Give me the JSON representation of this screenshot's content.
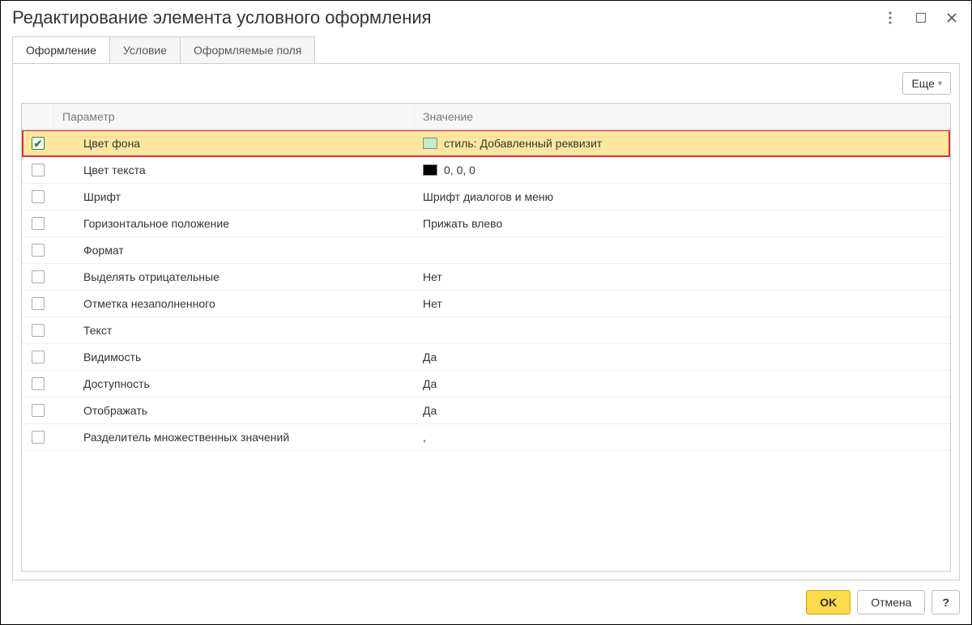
{
  "window": {
    "title": "Редактирование элемента условного оформления"
  },
  "tabs": {
    "design": "Оформление",
    "condition": "Условие",
    "fields": "Оформляемые поля",
    "active": "design"
  },
  "toolbar": {
    "more_label": "Еще"
  },
  "grid": {
    "header_param": "Параметр",
    "header_value": "Значение",
    "rows": [
      {
        "checked": true,
        "selected": true,
        "param": "Цвет фона",
        "value": "стиль: Добавленный реквизит",
        "swatch": "green"
      },
      {
        "checked": false,
        "selected": false,
        "param": "Цвет текста",
        "value": "0, 0, 0",
        "swatch": "black"
      },
      {
        "checked": false,
        "selected": false,
        "param": "Шрифт",
        "value": "Шрифт диалогов и меню",
        "swatch": null
      },
      {
        "checked": false,
        "selected": false,
        "param": "Горизонтальное положение",
        "value": "Прижать влево",
        "swatch": null
      },
      {
        "checked": false,
        "selected": false,
        "param": "Формат",
        "value": "",
        "swatch": null
      },
      {
        "checked": false,
        "selected": false,
        "param": "Выделять отрицательные",
        "value": "Нет",
        "swatch": null
      },
      {
        "checked": false,
        "selected": false,
        "param": "Отметка незаполненного",
        "value": "Нет",
        "swatch": null
      },
      {
        "checked": false,
        "selected": false,
        "param": "Текст",
        "value": "",
        "swatch": null
      },
      {
        "checked": false,
        "selected": false,
        "param": "Видимость",
        "value": "Да",
        "swatch": null
      },
      {
        "checked": false,
        "selected": false,
        "param": "Доступность",
        "value": "Да",
        "swatch": null
      },
      {
        "checked": false,
        "selected": false,
        "param": "Отображать",
        "value": "Да",
        "swatch": null
      },
      {
        "checked": false,
        "selected": false,
        "param": "Разделитель множественных значений",
        "value": ",",
        "swatch": null
      }
    ]
  },
  "footer": {
    "ok_label": "OK",
    "cancel_label": "Отмена",
    "help_label": "?"
  }
}
